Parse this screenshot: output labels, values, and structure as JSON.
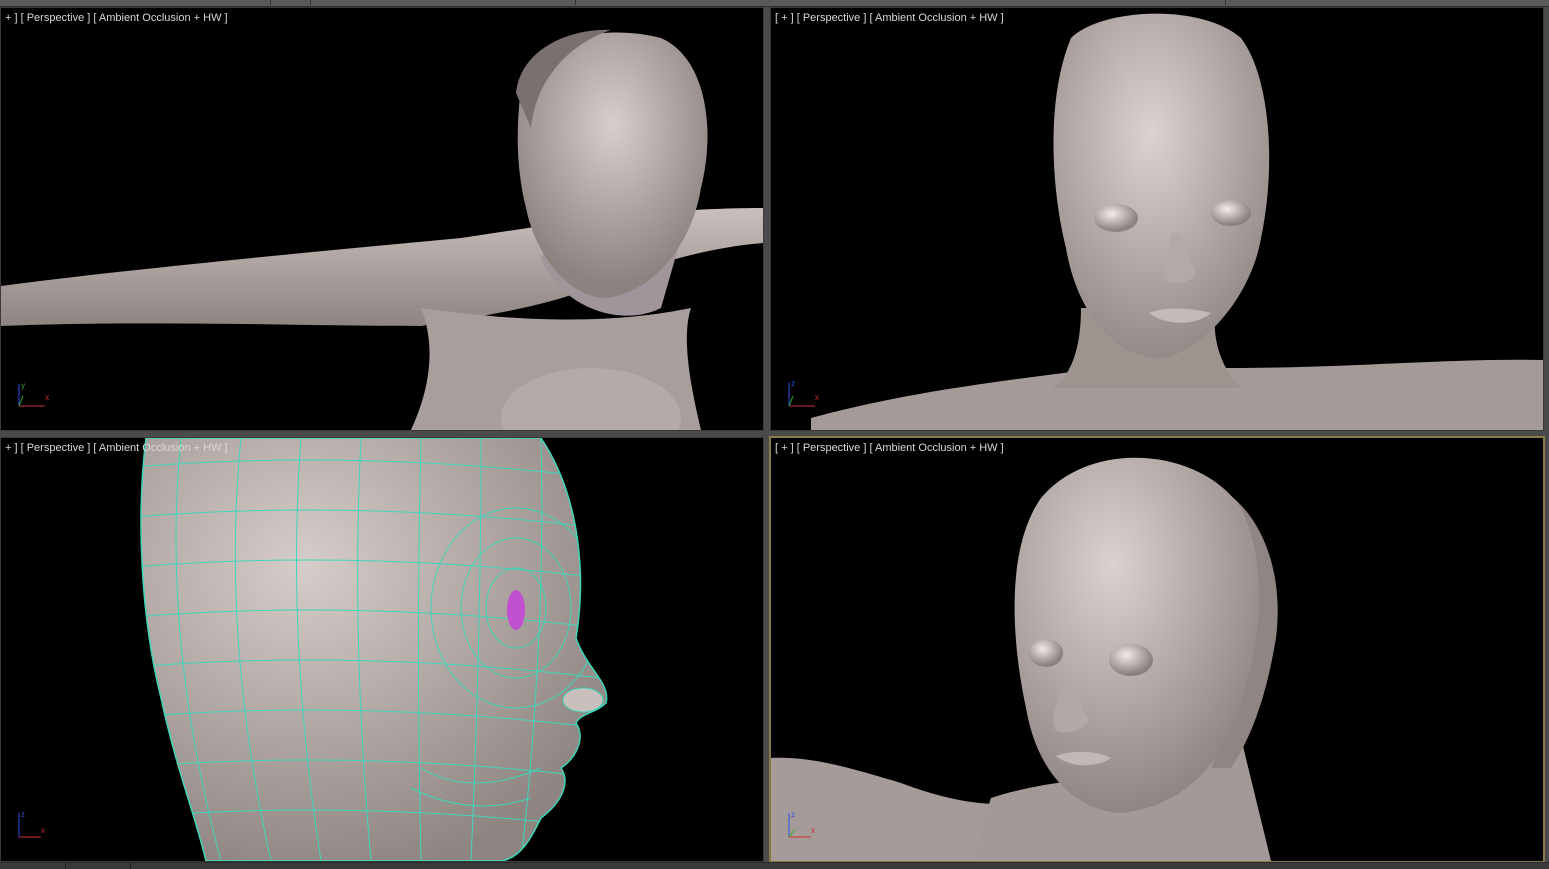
{
  "viewports": [
    {
      "id": "top-left",
      "plus": "+ ]",
      "view": "[ Perspective ]",
      "shading": "[ Ambient Occlusion + HW ]",
      "active": false
    },
    {
      "id": "top-right",
      "plus": "[ + ]",
      "view": "[ Perspective ]",
      "shading": "[ Ambient Occlusion + HW ]",
      "active": false
    },
    {
      "id": "bottom-left",
      "plus": "+ ]",
      "view": "[ Perspective ]",
      "shading": "[ Ambient Occlusion + HW ]",
      "active": false
    },
    {
      "id": "bottom-right",
      "plus": "[ + ]",
      "view": "[ Perspective ]",
      "shading": "[ Ambient Occlusion + HW ]",
      "active": true
    }
  ],
  "gizmo_labels": {
    "x": "x",
    "y": "y",
    "z": "z"
  },
  "colors": {
    "viewport_bg": "#000000",
    "skin": "#b8aeab",
    "wireframe": "#3fd6b8",
    "active_border": "#8a7a4a",
    "axis_x": "#d03030",
    "axis_y": "#30b030",
    "axis_z": "#3050e0"
  }
}
